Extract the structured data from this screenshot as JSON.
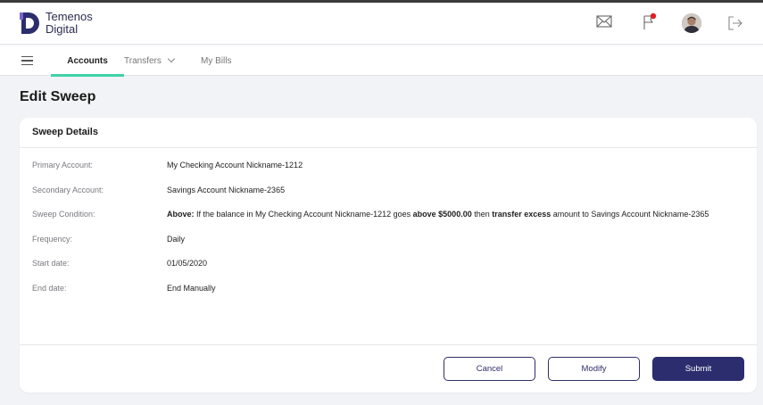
{
  "brand": {
    "line1": "Temenos",
    "line2": "Digital",
    "color": "#2b2d52"
  },
  "header_icons": [
    "mail-icon",
    "flag-icon",
    "avatar",
    "logout-icon"
  ],
  "nav": {
    "menu_icon": "hamburger-icon",
    "tabs": [
      {
        "label": "Accounts",
        "active": true
      },
      {
        "label": "Transfers",
        "has_dropdown": true
      },
      {
        "label": "My Bills"
      }
    ]
  },
  "page": {
    "title": "Edit Sweep"
  },
  "card": {
    "title": "Sweep Details",
    "rows": [
      {
        "label": "Primary Account:",
        "value": "My Checking Account Nickname-1212"
      },
      {
        "label": "Secondary Account:",
        "value": "Savings Account Nickname-2365"
      },
      {
        "label": "Sweep Condition:",
        "value_parts": [
          "Above:",
          " If the balance in My Checking Account Nickname-1212 goes ",
          "above $5000.00",
          " then ",
          "transfer excess",
          " amount to Savings Account Nickname-2365"
        ]
      },
      {
        "label": "Frequency:",
        "value": "Daily"
      },
      {
        "label": "Start date:",
        "value": "01/05/2020"
      },
      {
        "label": "End date:",
        "value": "End Manually"
      }
    ]
  },
  "buttons": {
    "cancel": "Cancel",
    "modify": "Modify",
    "submit": "Submit"
  },
  "colors": {
    "accent": "#3fd1a8",
    "primary": "#2b2d6e",
    "notification": "#e0201c"
  }
}
